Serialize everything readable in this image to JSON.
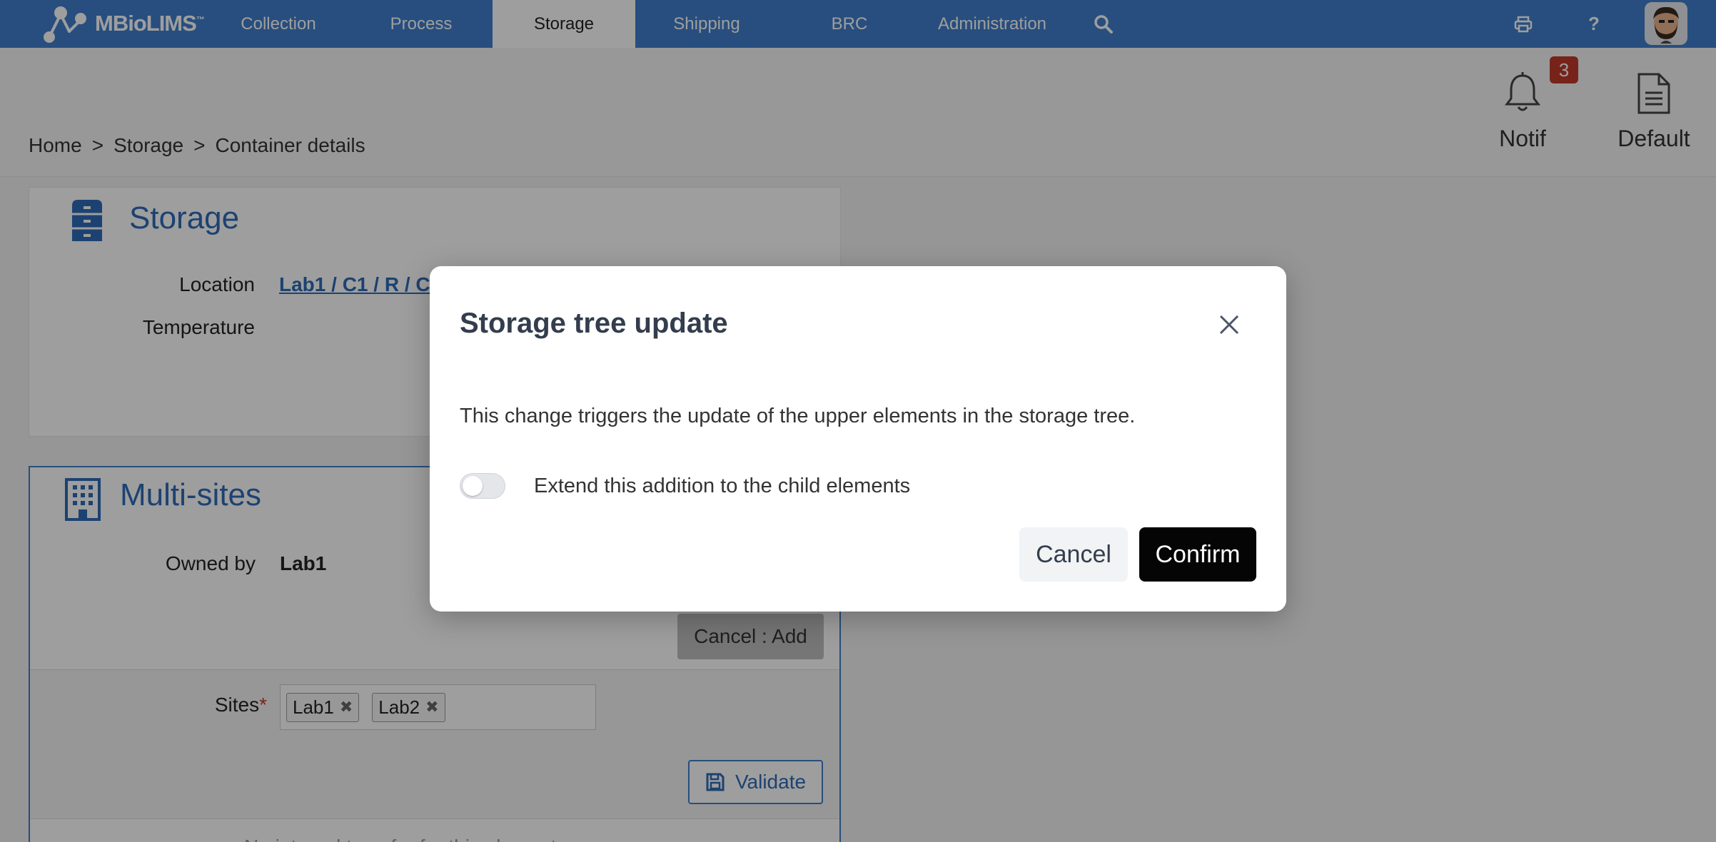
{
  "app": {
    "logo_text": "MBioLIMS",
    "logo_tm": "™"
  },
  "nav": {
    "items": [
      {
        "label": "Collection"
      },
      {
        "label": "Process"
      },
      {
        "label": "Storage",
        "active": true
      },
      {
        "label": "Shipping"
      },
      {
        "label": "BRC"
      },
      {
        "label": "Administration"
      }
    ],
    "icons": [
      "search-icon",
      "print-icon",
      "help-icon",
      "avatar"
    ]
  },
  "breadcrumb": {
    "items": [
      "Home",
      "Storage",
      "Container details"
    ],
    "separator": ">"
  },
  "tools": {
    "notif_label": "Notif",
    "notif_count": "3",
    "default_label": "Default"
  },
  "storage_panel": {
    "title": "Storage",
    "location_label": "Location",
    "location_value": "Lab1 / C1 / R / C",
    "temperature_label": "Temperature"
  },
  "multisites_panel": {
    "title": "Multi-sites",
    "owned_by_label": "Owned by",
    "owned_by_value": "Lab1",
    "cancel_add_label": "Cancel : Add",
    "sites_label": "Sites",
    "sites_required": "*",
    "sites": [
      "Lab1",
      "Lab2"
    ],
    "tag_remove": "✖",
    "validate_label": "Validate",
    "trailing_text": "No internal transfer for this element"
  },
  "modal": {
    "title": "Storage tree update",
    "message": "This change triggers the update of the upper elements in the storage tree.",
    "toggle_label": "Extend this addition to the child elements",
    "toggle_on": false,
    "cancel_label": "Cancel",
    "confirm_label": "Confirm"
  },
  "colors": {
    "nav_bg": "#3f7fcb",
    "accent": "#2e6bb7",
    "badge": "#c0392b",
    "confirm_bg": "#050505"
  }
}
